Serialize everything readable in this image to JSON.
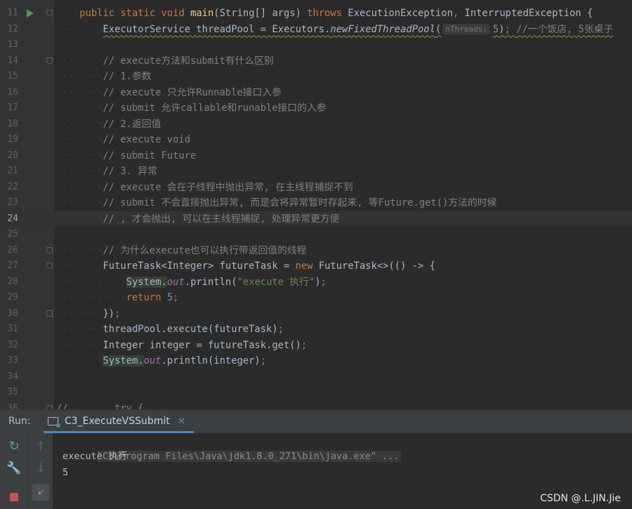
{
  "editor": {
    "lines": [
      {
        "n": "11",
        "run": true,
        "fold": "start",
        "html": "<span class=\"guide\">····</span><span class=\"kw\">public static void </span><span class=\"fn\">main</span>(String[] args) <span class=\"kw\">throws </span>ExecutionException<span class=\"kw\">, </span>InterruptedException {"
      },
      {
        "n": "12",
        "html": "<span class=\"guide\">········</span><span class=\"squiggle\">ExecutorService threadPool = Executors.<span class=\"it\">newFixedThreadPool</span>(<span class=\"hint\">nThreads:</span><span class=\"num\">5</span>)<span class=\"kw\">; </span><span class=\"cm\">//一个饭店, 5张桌子</span></span>"
      },
      {
        "n": "13",
        "html": ""
      },
      {
        "n": "14",
        "fold": "start",
        "html": "<span class=\"guide\">········</span><span class=\"cm\">// execute方法和submit有什么区别</span>"
      },
      {
        "n": "15",
        "html": "<span class=\"guide\">········</span><span class=\"cm\">// 1.参数</span>"
      },
      {
        "n": "16",
        "html": "<span class=\"guide\">········</span><span class=\"cm\">// execute 只允许Runnable接口入参</span>"
      },
      {
        "n": "17",
        "html": "<span class=\"guide\">········</span><span class=\"cm\">// submit 允许callable和runable接口的入参</span>"
      },
      {
        "n": "18",
        "html": "<span class=\"guide\">········</span><span class=\"cm\">// 2.返回值</span>"
      },
      {
        "n": "19",
        "html": "<span class=\"guide\">········</span><span class=\"cm\">// execute void</span>"
      },
      {
        "n": "20",
        "html": "<span class=\"guide\">········</span><span class=\"cm\">// submit Future</span>"
      },
      {
        "n": "21",
        "html": "<span class=\"guide\">········</span><span class=\"cm\">// 3. 异常</span>"
      },
      {
        "n": "22",
        "html": "<span class=\"guide\">········</span><span class=\"cm\">// execute 会在子线程中抛出异常, 在主线程捕捉不到</span>"
      },
      {
        "n": "23",
        "html": "<span class=\"guide\">········</span><span class=\"cm\">// submit 不会直接抛出异常, 而是会将异常暂时存起来, 等Future.get()方法的时候</span>"
      },
      {
        "n": "24",
        "current": true,
        "html": "<span class=\"guide\">········</span><span class=\"cm\">// , 才会抛出, 可以在主线程捕捉, 处理异常更方便</span>"
      },
      {
        "n": "25",
        "html": ""
      },
      {
        "n": "26",
        "fold": "start",
        "html": "<span class=\"guide\">········</span><span class=\"cm\">// 为什么execute也可以执行带返回值的线程</span>"
      },
      {
        "n": "27",
        "fold": "start",
        "html": "<span class=\"guide\">········</span>FutureTask&lt;Integer&gt; futureTask = <span class=\"kw\">new </span>FutureTask&lt;&gt;(() -&gt; {"
      },
      {
        "n": "28",
        "html": "<span class=\"guide\">············</span><span class=\"hlsys\">System.</span><span class=\"fld\">out</span>.println(<span class=\"str\">\"execute 执行\"</span>)<span class=\"kw\">;</span>"
      },
      {
        "n": "29",
        "html": "<span class=\"guide\">············</span><span class=\"kw\">return </span><span class=\"num\">5</span><span class=\"kw\">;</span>"
      },
      {
        "n": "30",
        "fold": "end",
        "html": "<span class=\"guide\">········</span>})<span class=\"kw\">;</span>"
      },
      {
        "n": "31",
        "html": "<span class=\"guide\">········</span>threadPool.execute(futureTask)<span class=\"kw\">;</span>"
      },
      {
        "n": "32",
        "html": "<span class=\"guide\">········</span>Integer integer = futureTask.get()<span class=\"kw\">;</span>"
      },
      {
        "n": "33",
        "html": "<span class=\"guide\">········</span><span class=\"hlsys\">System.</span><span class=\"fld\">out</span>.println(integer)<span class=\"kw\">;</span>"
      },
      {
        "n": "34",
        "html": ""
      },
      {
        "n": "35",
        "html": ""
      },
      {
        "n": "36",
        "fold": "start",
        "html": "<span class=\"cm\">//        try {</span>"
      }
    ]
  },
  "run_panel": {
    "label": "Run:",
    "tab_title": "C3_ExecuteVSSubmit",
    "tab_close": "✕",
    "console": {
      "command": "\"C:\\Program Files\\Java\\jdk1.8.0_271\\bin\\java.exe\" ...",
      "output": [
        "execute 执行",
        "5"
      ]
    }
  },
  "watermark": "CSDN @.L.JIN.Jie",
  "colors": {
    "background": "#2b2b2b",
    "keyword": "#cc7832",
    "method": "#ffc66d",
    "comment": "#808080",
    "number": "#6897bb",
    "string": "#6a8759",
    "accent": "#4a88c7"
  }
}
